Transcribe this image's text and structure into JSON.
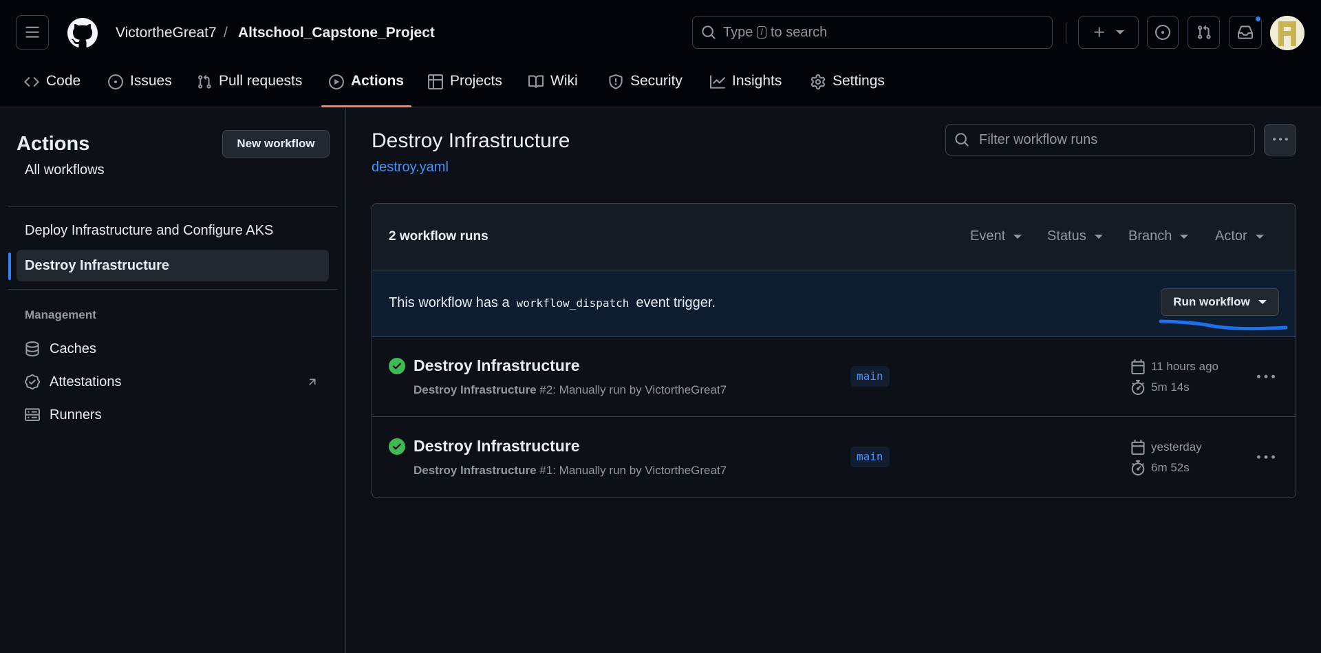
{
  "header": {
    "owner": "VictortheGreat7",
    "separator": "/",
    "repo": "Altschool_Capstone_Project",
    "search_prefix": "Type",
    "search_key": "/",
    "search_suffix": "to search"
  },
  "tabs": [
    {
      "label": "Code",
      "icon": "code-icon"
    },
    {
      "label": "Issues",
      "icon": "issue-opened-icon"
    },
    {
      "label": "Pull requests",
      "icon": "git-pull-request-icon"
    },
    {
      "label": "Actions",
      "icon": "play-icon",
      "active": true
    },
    {
      "label": "Projects",
      "icon": "table-icon"
    },
    {
      "label": "Wiki",
      "icon": "book-icon"
    },
    {
      "label": "Security",
      "icon": "shield-icon"
    },
    {
      "label": "Insights",
      "icon": "graph-icon"
    },
    {
      "label": "Settings",
      "icon": "gear-icon"
    }
  ],
  "sidebar": {
    "title": "Actions",
    "new_workflow": "New workflow",
    "all_workflows": "All workflows",
    "workflows": [
      {
        "label": "Deploy Infrastructure and Configure AKS"
      },
      {
        "label": "Destroy Infrastructure",
        "active": true
      }
    ],
    "management_heading": "Management",
    "management": [
      {
        "label": "Caches",
        "icon": "database-icon"
      },
      {
        "label": "Attestations",
        "icon": "verified-icon"
      },
      {
        "label": "Runners",
        "icon": "server-icon"
      }
    ]
  },
  "main": {
    "title": "Destroy Infrastructure",
    "file": "destroy.yaml",
    "filter_placeholder": "Filter workflow runs",
    "runs_count": "2 workflow runs",
    "filters": [
      "Event",
      "Status",
      "Branch",
      "Actor"
    ],
    "dispatch_before": "This workflow has a",
    "dispatch_code": "workflow_dispatch",
    "dispatch_after": "event trigger.",
    "run_workflow": "Run workflow",
    "runs": [
      {
        "title": "Destroy Infrastructure",
        "workflow": "Destroy Infrastructure",
        "detail": "#2: Manually run by VictortheGreat7",
        "branch": "main",
        "when": "11 hours ago",
        "duration": "5m 14s",
        "status": "success"
      },
      {
        "title": "Destroy Infrastructure",
        "workflow": "Destroy Infrastructure",
        "detail": "#1: Manually run by VictortheGreat7",
        "branch": "main",
        "when": "yesterday",
        "duration": "6m 52s",
        "status": "success"
      }
    ]
  },
  "colors": {
    "background": "#0d1117",
    "header": "#010409",
    "accent": "#f78166",
    "link": "#4493f8",
    "success": "#3fb950"
  }
}
